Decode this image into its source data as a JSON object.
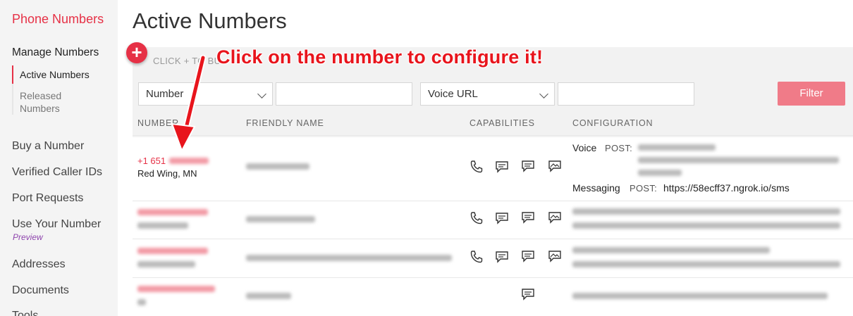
{
  "sidebar": {
    "title": "Phone Numbers",
    "manage": "Manage Numbers",
    "sub_items": [
      {
        "label": "Active Numbers"
      },
      {
        "label": "Released\nNumbers"
      }
    ],
    "items": [
      {
        "label": "Buy a Number"
      },
      {
        "label": "Verified Caller IDs"
      },
      {
        "label": "Port Requests"
      },
      {
        "label": "Use Your Number"
      },
      {
        "label": "Addresses"
      },
      {
        "label": "Documents"
      },
      {
        "label": "Tools"
      }
    ],
    "preview_badge": "Preview"
  },
  "main": {
    "title": "Active Numbers",
    "add_hint": "CLICK + TO BU",
    "filters": {
      "field1": "Number",
      "field2": "Voice URL",
      "button": "Filter"
    },
    "columns": [
      "NUMBER",
      "FRIENDLY NAME",
      "CAPABILITIES",
      "CONFIGURATION"
    ],
    "rows": [
      {
        "number": "+1 651",
        "location": "Red Wing, MN",
        "capabilities": [
          "voice",
          "sms",
          "mms"
        ],
        "config": {
          "voice_label": "Voice",
          "voice_method": "POST:",
          "messaging_label": "Messaging",
          "messaging_method": "POST:",
          "messaging_url": "https://58ecff37.ngrok.io/sms"
        }
      }
    ]
  },
  "annotation": {
    "callout": "Click on the number to configure it!"
  },
  "colors": {
    "accent": "#e63146",
    "filter_button": "#f07b88",
    "callout": "#e8141c"
  }
}
